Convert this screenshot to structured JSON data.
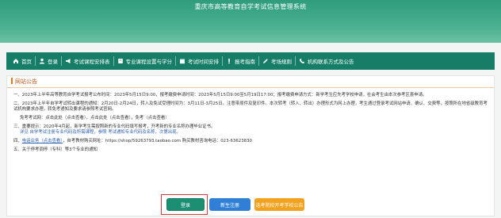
{
  "site_title": "重庆市高等教育自学考试信息管理系统",
  "nav": {
    "items": [
      {
        "name": "home",
        "label": "首页",
        "icon": "home-icon"
      },
      {
        "name": "login",
        "label": "登录",
        "icon": "user-icon"
      },
      {
        "name": "exam-plan",
        "label": "考试课程安排表",
        "icon": "megaphone-icon"
      },
      {
        "name": "majors",
        "label": "专业课程设置与学分",
        "icon": "book-icon"
      },
      {
        "name": "schedule",
        "label": "考试时间安排",
        "icon": "calendar-icon"
      },
      {
        "name": "guide",
        "label": "报考指南",
        "icon": "info-icon"
      },
      {
        "name": "rules",
        "label": "考场规则",
        "icon": "pencil-icon"
      },
      {
        "name": "contact",
        "label": "机构联系方式及公告",
        "icon": "phone-icon"
      }
    ]
  },
  "panel": {
    "heading": "网站公告"
  },
  "notices": [
    {
      "n": "一、",
      "text": "2023年上半年高等教育自学考试报考公布时间：2023年5月15日9:00，报考缴费申请时间：2023年5月15日9:00至5月19日17:00；报考缴费申请方式：新学考生应先考学校申请，社会考生由本次参考区县申请。"
    },
    {
      "n": "二、",
      "text": "2023年上半年自学考试转出课程的通知：2月20日-2月24日，转入及免试受理时间为：3月11日-3月25日。注意带原件及复印件。本次转考（转入、转出）办理形式为网上办理，考生通过登录考试网站申请、确认、交费等，按照所在地省级教育考试机构要求办理。转免考通知及要求请参照考试官网。"
    },
    {
      "n": "",
      "text": "免考考试网：点击此处（点击查看），点击此处（点击查看），免考（点击查看）"
    },
    {
      "n": "三、",
      "text": "重要提示：2020年4月起，新学考生需按照新的专业代码填写报考，开考新的专业名称办理毕业证书。",
      "text2": "详见 自学考试注册专业代码及所需课程，参照 考试通知专业代码及名称，次第出现。"
    },
    {
      "n": "四、",
      "link": "电话业务（点击查看）",
      "text": "，自考教材购买网址：https://shop/59263793.taobao.com 购买教材咨询电话：023-63623830"
    },
    {
      "n": "五、",
      "text": "关于停考调停（专科）等3个专业的通知"
    }
  ],
  "buttons": {
    "login": "登录",
    "register": "新生注册",
    "college": "选考院校开考学校公告"
  },
  "colors": {
    "banner": "#2f9c7c",
    "navbar": "#167e67",
    "login_button": "#1c8f72",
    "register_button": "#2f7fd6",
    "college_button": "#f2a21c",
    "highlight": "#d43c3c"
  }
}
